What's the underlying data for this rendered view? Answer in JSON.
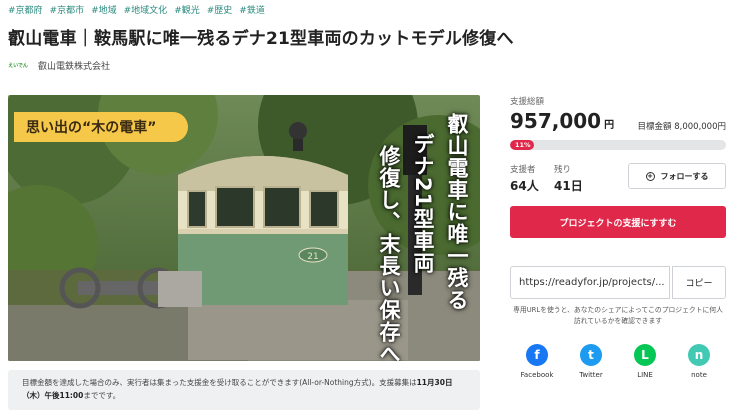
{
  "tags": [
    "#京都府",
    "#京都市",
    "#地域",
    "#地域文化",
    "#観光",
    "#歴史",
    "#鉄道"
  ],
  "title": "叡山電車｜鞍馬駅に唯一残るデナ21型車両のカットモデル修復へ",
  "organizer": {
    "logo_text": "えいでん",
    "name": "叡山電鉄株式会社"
  },
  "hero": {
    "badge": "思い出の“木の電車”",
    "vertical_lines": [
      "叡山電車に唯一残る",
      "デナ21型車両",
      "修復し、末長い保存へ"
    ],
    "car_number": "21"
  },
  "notice": {
    "text_before": "目標金額を達成した場合のみ、実行者は集まった支援金を受け取ることができます(All-or-Nothing方式)。支援募集は",
    "deadline": "11月30日（木）午後11:00",
    "text_after": "までです。"
  },
  "funding": {
    "raised_label": "支援総額",
    "raised_amount": "957,000",
    "currency": "円",
    "target_text": "目標金額 8,000,000円",
    "percent_label": "11%",
    "percent": 11,
    "supporters_label": "支援者",
    "supporters_value": "64人",
    "remaining_label": "残り",
    "remaining_value": "41日"
  },
  "buttons": {
    "follow_label": "フォローする",
    "support_label": "プロジェクトの支援にすすむ",
    "copy_label": "コピー"
  },
  "share": {
    "url_value": "https://readyfor.jp/projects/...",
    "note": "専用URLを使うと、あなたのシェアによってこのプロジェクトに何人訪れているかを確認できます"
  },
  "socials": [
    {
      "label": "Facebook",
      "icon": "facebook-icon",
      "color": "#1877f2",
      "glyph": "f"
    },
    {
      "label": "Twitter",
      "icon": "twitter-icon",
      "color": "#1d9bf0",
      "glyph": "t"
    },
    {
      "label": "LINE",
      "icon": "line-icon",
      "color": "#06c755",
      "glyph": "L"
    },
    {
      "label": "note",
      "icon": "note-icon",
      "color": "#41c9b4",
      "glyph": "n"
    }
  ],
  "colors": {
    "accent": "#e0284a",
    "tag": "#2a8a7e",
    "badge": "#f5c84a"
  }
}
